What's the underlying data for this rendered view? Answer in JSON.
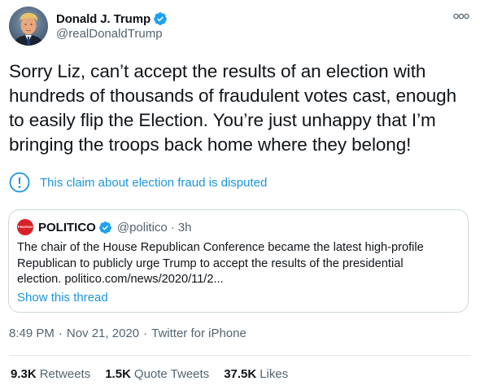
{
  "author": {
    "name": "Donald J. Trump",
    "handle": "@realDonaldTrump",
    "verified": true,
    "avatar_icon": "profile-photo"
  },
  "more_icon": "more-options-icon",
  "tweet": {
    "lines": [
      "Sorry Liz, can’t accept the results of an election with",
      "hundreds of thousands of fraudulent votes cast, enough",
      "to easily flip the Election. You’re just unhappy that I’m",
      "bringing the troops back home where they belong!"
    ]
  },
  "notice": {
    "icon": "exclamation-circle-icon",
    "text": "This claim about election fraud is disputed",
    "color": "#1b95e0"
  },
  "quote": {
    "avatar_text": "POLITICO",
    "avatar_color": "#d92027",
    "name": "POLITICO",
    "verified": true,
    "handle": "@politico",
    "separator": "·",
    "time": "3h",
    "lines": [
      "The chair of the House Republican Conference became the latest high-profile",
      "Republican to publicly urge Trump to accept the results of the presidential",
      "election. politico.com/news/2020/11/2..."
    ],
    "show_thread": "Show this thread"
  },
  "meta": {
    "time": "8:49 PM",
    "sep1": "·",
    "date": "Nov 21, 2020",
    "sep2": "·",
    "source": "Twitter for iPhone"
  },
  "stats": {
    "retweets_count": "9.3K",
    "retweets_label": "Retweets",
    "quotes_count": "1.5K",
    "quotes_label": "Quote Tweets",
    "likes_count": "37.5K",
    "likes_label": "Likes"
  },
  "colors": {
    "accent": "#1b95e0",
    "verified": "#1da1f2",
    "text": "#0f1419",
    "secondary": "#536471",
    "border": "#cfd9de"
  }
}
